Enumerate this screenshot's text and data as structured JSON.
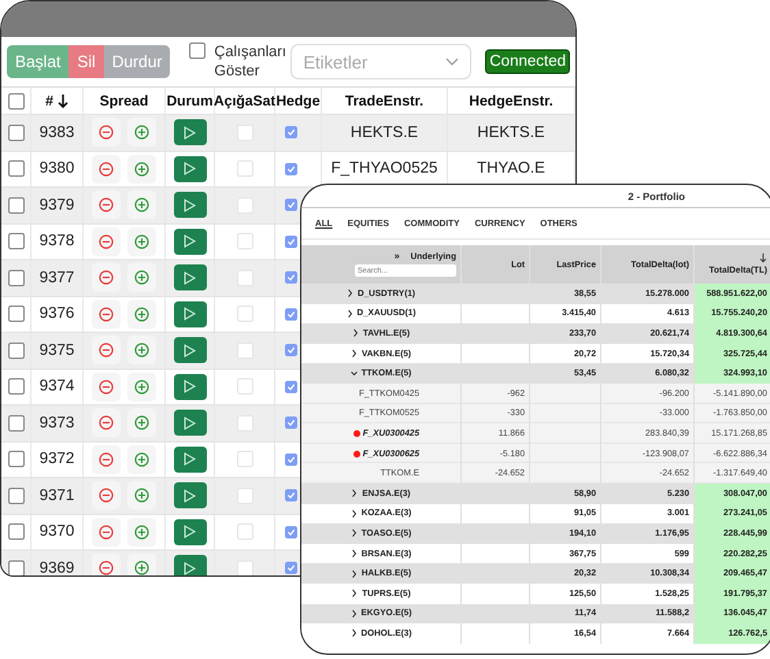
{
  "back_window": {
    "toolbar": {
      "buttons": [
        {
          "label": "Başlat",
          "kind": "start"
        },
        {
          "label": "Sil",
          "kind": "delete"
        },
        {
          "label": "Durdur",
          "kind": "stop"
        }
      ],
      "show_workers": {
        "label": "Çalışanları Göster",
        "checked": false
      },
      "tags": {
        "placeholder": "Etiketler"
      },
      "status": "Connected"
    },
    "table": {
      "columns": [
        "#",
        "Spread",
        "Durum",
        "AçığaSat",
        "Hedge",
        "TradeEnstr.",
        "HedgeEnstr."
      ],
      "all_checked": false,
      "rows": [
        {
          "id": "9383",
          "checked": false,
          "short_sell": false,
          "hedge": true,
          "trade": "HEKTS.E",
          "hedge_instr": "HEKTS.E"
        },
        {
          "id": "9380",
          "checked": false,
          "short_sell": false,
          "hedge": true,
          "trade": "F_THYAO0525",
          "hedge_instr": "THYAO.E"
        },
        {
          "id": "9379",
          "checked": false,
          "short_sell": false,
          "hedge": true
        },
        {
          "id": "9378",
          "checked": false,
          "short_sell": false,
          "hedge": true
        },
        {
          "id": "9377",
          "checked": false,
          "short_sell": false,
          "hedge": true
        },
        {
          "id": "9376",
          "checked": false,
          "short_sell": false,
          "hedge": true
        },
        {
          "id": "9375",
          "checked": false,
          "short_sell": false,
          "hedge": true
        },
        {
          "id": "9374",
          "checked": false,
          "short_sell": false,
          "hedge": true
        },
        {
          "id": "9373",
          "checked": false,
          "short_sell": false,
          "hedge": true
        },
        {
          "id": "9372",
          "checked": false,
          "short_sell": false,
          "hedge": true
        },
        {
          "id": "9371",
          "checked": false,
          "short_sell": false,
          "hedge": true
        },
        {
          "id": "9370",
          "checked": false,
          "short_sell": false,
          "hedge": true
        },
        {
          "id": "9369",
          "checked": false,
          "short_sell": false,
          "hedge": true
        }
      ]
    }
  },
  "portfolio_window": {
    "title": "2 - Portfolio",
    "tabs": [
      {
        "label": "ALL",
        "selected": true
      },
      {
        "label": "EQUITIES",
        "selected": false
      },
      {
        "label": "COMMODITY",
        "selected": false
      },
      {
        "label": "CURRENCY",
        "selected": false
      },
      {
        "label": "OTHERS",
        "selected": false
      }
    ],
    "expand_all": "»",
    "search": {
      "placeholder": "Search..."
    },
    "columns": [
      "Underlying",
      "Lot",
      "LastPrice",
      "TotalDelta(lot)",
      "TotalDelta(TL)"
    ],
    "rows": [
      {
        "underlying": "D_USDTRY(1)",
        "expanded": false,
        "last_price": "38,55",
        "delta_lot": "15.278.000",
        "delta_tl": "588.951.622,00"
      },
      {
        "underlying": "D_XAUUSD(1)",
        "expanded": false,
        "last_price": "3.415,40",
        "delta_lot": "4.613",
        "delta_tl": "15.755.240,20"
      },
      {
        "underlying": "TAVHL.E(5)",
        "expanded": false,
        "last_price": "233,70",
        "delta_lot": "20.621,74",
        "delta_tl": "4.819.300,64"
      },
      {
        "underlying": "VAKBN.E(5)",
        "expanded": false,
        "last_price": "20,72",
        "delta_lot": "15.720,34",
        "delta_tl": "325.725,44"
      },
      {
        "underlying": "TTKOM.E(5)",
        "expanded": true,
        "last_price": "53,45",
        "delta_lot": "6.080,32",
        "delta_tl": "324.993,10",
        "children": [
          {
            "instrument": "F_TTKOM0425",
            "flagged": false,
            "lot": "-962",
            "delta_lot": "-96.200",
            "delta_tl": "-5.141.890,00"
          },
          {
            "instrument": "F_TTKOM0525",
            "flagged": false,
            "lot": "-330",
            "delta_lot": "-33.000",
            "delta_tl": "-1.763.850,00"
          },
          {
            "instrument": "F_XU0300425",
            "flagged": true,
            "lot": "11.866",
            "delta_lot": "283.840,39",
            "delta_tl": "15.171.268,85"
          },
          {
            "instrument": "F_XU0300625",
            "flagged": true,
            "lot": "-5.180",
            "delta_lot": "-123.908,07",
            "delta_tl": "-6.622.886,34"
          },
          {
            "instrument": "TTKOM.E",
            "flagged": false,
            "lot": "-24.652",
            "delta_lot": "-24.652",
            "delta_tl": "-1.317.649,40"
          }
        ]
      },
      {
        "underlying": "ENJSA.E(3)",
        "expanded": false,
        "last_price": "58,90",
        "delta_lot": "5.230",
        "delta_tl": "308.047,00"
      },
      {
        "underlying": "KOZAA.E(3)",
        "expanded": false,
        "last_price": "91,05",
        "delta_lot": "3.001",
        "delta_tl": "273.241,05"
      },
      {
        "underlying": "TOASO.E(5)",
        "expanded": false,
        "last_price": "194,10",
        "delta_lot": "1.176,95",
        "delta_tl": "228.445,99"
      },
      {
        "underlying": "BRSAN.E(3)",
        "expanded": false,
        "last_price": "367,75",
        "delta_lot": "599",
        "delta_tl": "220.282,25"
      },
      {
        "underlying": "HALKB.E(5)",
        "expanded": false,
        "last_price": "20,32",
        "delta_lot": "10.308,34",
        "delta_tl": "209.465,47"
      },
      {
        "underlying": "TUPRS.E(5)",
        "expanded": false,
        "last_price": "125,50",
        "delta_lot": "1.528,25",
        "delta_tl": "191.795,37"
      },
      {
        "underlying": "EKGYO.E(5)",
        "expanded": false,
        "last_price": "11,74",
        "delta_lot": "11.588,2",
        "delta_tl": "136.045,47"
      },
      {
        "underlying": "DOHOL.E(3)",
        "expanded": false,
        "last_price": "16,54",
        "delta_lot": "7.664",
        "delta_tl": "126.762,5"
      }
    ]
  }
}
